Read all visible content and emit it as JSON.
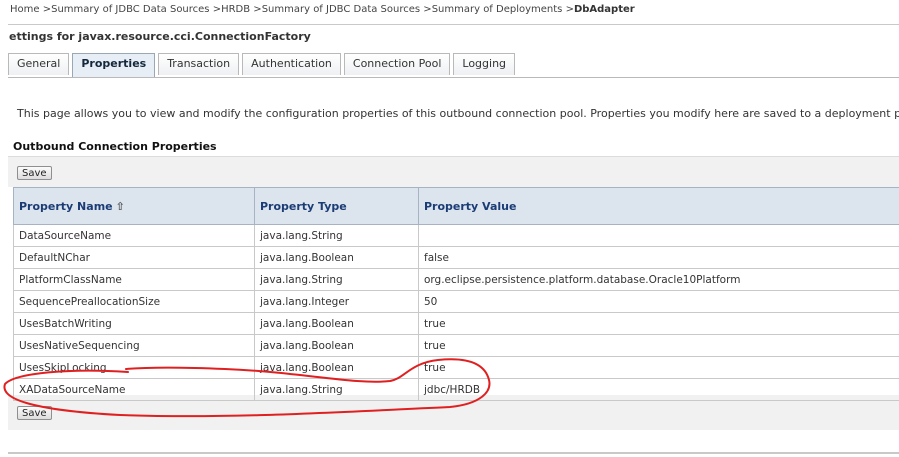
{
  "breadcrumb": {
    "items": [
      "Home",
      "Summary of JDBC Data Sources",
      "HRDB",
      "Summary of JDBC Data Sources",
      "Summary of Deployments"
    ],
    "current": "DbAdapter",
    "separator": " >"
  },
  "page_title": "ettings for javax.resource.cci.ConnectionFactory",
  "tabs": [
    {
      "label": "General",
      "active": false
    },
    {
      "label": "Properties",
      "active": true
    },
    {
      "label": "Transaction",
      "active": false
    },
    {
      "label": "Authentication",
      "active": false
    },
    {
      "label": "Connection Pool",
      "active": false
    },
    {
      "label": "Logging",
      "active": false
    }
  ],
  "intro_text": "This page allows you to view and modify the configuration properties of this outbound connection pool. Properties you modify here are saved to a deployment plan.",
  "section_title": "Outbound Connection Properties",
  "buttons": {
    "save_top": "Save",
    "save_bottom": "Save"
  },
  "table": {
    "headers": {
      "name": "Property Name",
      "type": "Property Type",
      "value": "Property Value"
    },
    "sort_icon": "sort-ascending-icon",
    "rows": [
      {
        "name": "DataSourceName",
        "type": "java.lang.String",
        "value": ""
      },
      {
        "name": "DefaultNChar",
        "type": "java.lang.Boolean",
        "value": "false"
      },
      {
        "name": "PlatformClassName",
        "type": "java.lang.String",
        "value": "org.eclipse.persistence.platform.database.Oracle10Platform"
      },
      {
        "name": "SequencePreallocationSize",
        "type": "java.lang.Integer",
        "value": "50"
      },
      {
        "name": "UsesBatchWriting",
        "type": "java.lang.Boolean",
        "value": "true"
      },
      {
        "name": "UsesNativeSequencing",
        "type": "java.lang.Boolean",
        "value": "true"
      },
      {
        "name": "UsesSkipLocking",
        "type": "java.lang.Boolean",
        "value": "true"
      },
      {
        "name": "XADataSourceName",
        "type": "java.lang.String",
        "value": "jdbc/HRDB"
      }
    ]
  },
  "colors": {
    "header_text": "#1b3c74",
    "annotation_stroke": "#e02020"
  }
}
